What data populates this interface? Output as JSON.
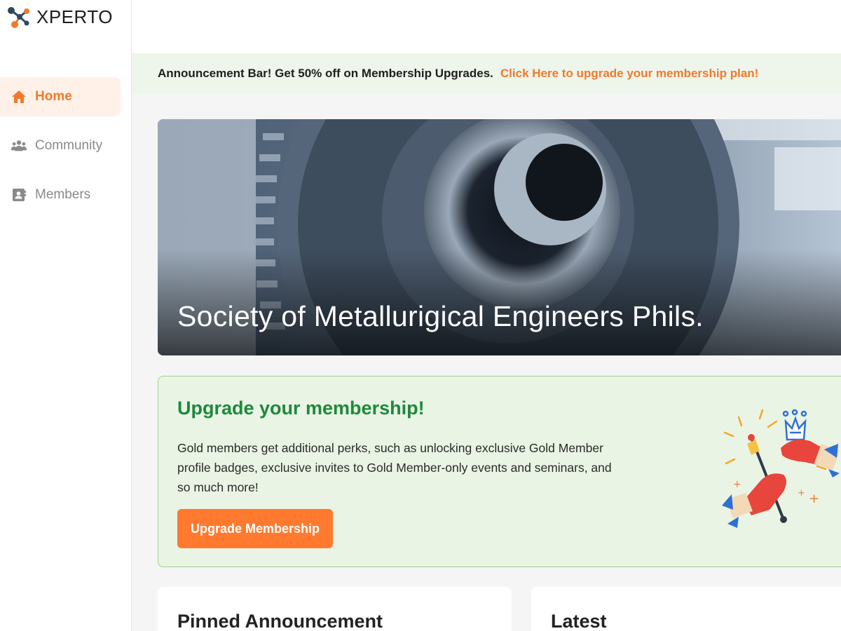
{
  "app": {
    "logo_text": "XPERTO",
    "brand_color": "#f07a2b",
    "accent_green": "#1c8a3c"
  },
  "sidebar": {
    "items": [
      {
        "label": "Home",
        "icon": "home-icon",
        "active": true
      },
      {
        "label": "Community",
        "icon": "community-icon",
        "active": false
      },
      {
        "label": "Members",
        "icon": "members-icon",
        "active": false
      }
    ]
  },
  "announcement": {
    "text": "Announcement Bar! Get 50% off on Membership Upgrades.",
    "link_text": "Click Here to upgrade your membership plan!"
  },
  "hero": {
    "title": "Society of Metallurigical Engineers Phils."
  },
  "upgrade": {
    "title": "Upgrade your membership!",
    "description": "Gold members get additional perks, such as unlocking exclusive Gold Member profile badges, exclusive invites to Gold Member-only events and seminars, and so much more!",
    "button_label": "Upgrade Membership",
    "illustration": "celebration-hands-crown-illustration"
  },
  "cards": {
    "pinned_title": "Pinned Announcement",
    "latest_title": "Latest"
  }
}
